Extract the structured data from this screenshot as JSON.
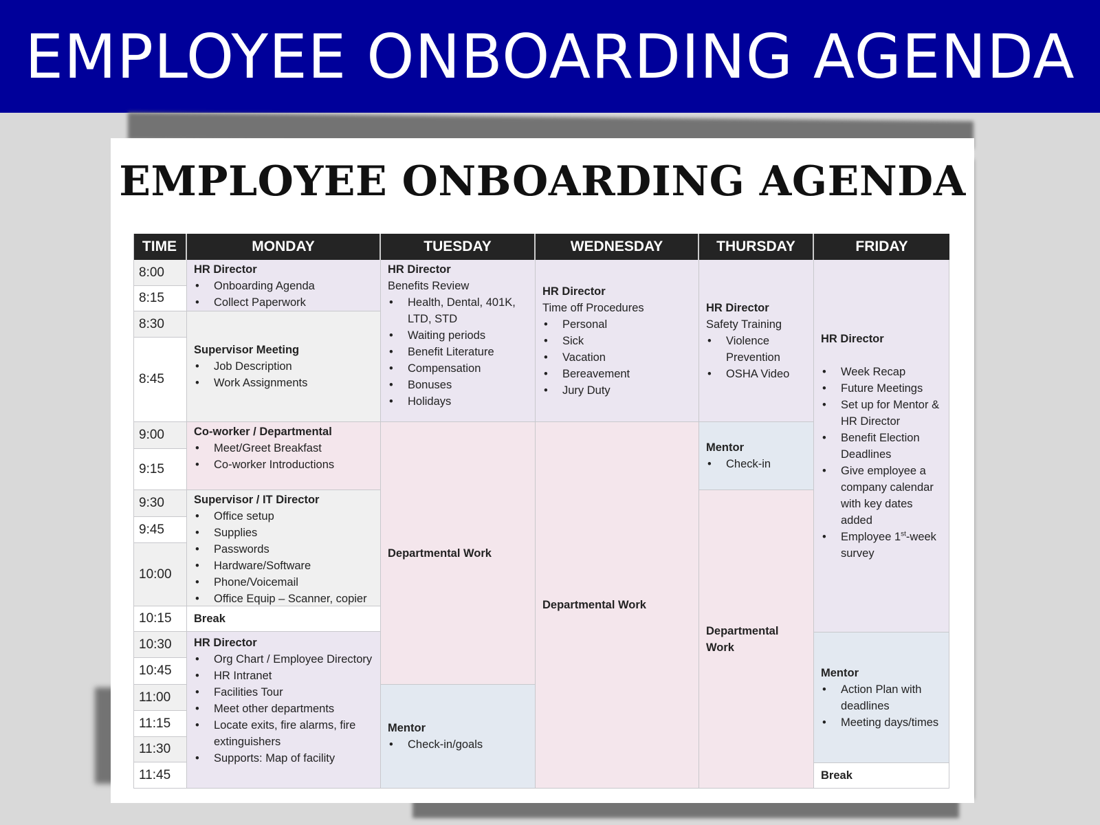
{
  "banner_title": "EMPLOYEE ONBOARDING AGENDA",
  "document_title": "EMPLOYEE ONBOARDING AGENDA",
  "headers": [
    "TIME",
    "MONDAY",
    "TUESDAY",
    "WEDNESDAY",
    "THURSDAY",
    "FRIDAY"
  ],
  "times": [
    "8:00",
    "8:15",
    "8:30",
    "8:45",
    "9:00",
    "9:15",
    "9:30",
    "9:45",
    "10:00",
    "10:15",
    "10:30",
    "10:45",
    "11:00",
    "11:15",
    "11:30",
    "11:45"
  ],
  "monday": {
    "block1": {
      "role": "HR Director",
      "items": [
        "Onboarding Agenda",
        "Collect Paperwork"
      ]
    },
    "block2": {
      "role": "Supervisor Meeting",
      "items": [
        "Job Description",
        "Work Assignments"
      ]
    },
    "block3": {
      "role": "Co-worker / Departmental",
      "items": [
        "Meet/Greet Breakfast",
        "Co-worker Introductions"
      ]
    },
    "block4": {
      "role": "Supervisor / IT Director",
      "items": [
        "Office setup",
        "Supplies",
        "Passwords",
        "Hardware/Software",
        "Phone/Voicemail",
        "Office Equip – Scanner, copier"
      ]
    },
    "block5": {
      "role": "Break"
    },
    "block6": {
      "role": "HR Director",
      "items": [
        "Org Chart / Employee Directory",
        "HR Intranet",
        "Facilities Tour",
        "Meet other departments",
        "Locate exits, fire alarms, fire extinguishers",
        "Supports: Map of facility"
      ]
    }
  },
  "tuesday": {
    "block1": {
      "role": "HR Director",
      "subtitle": "Benefits Review",
      "items": [
        "Health, Dental, 401K, LTD, STD",
        "Waiting periods",
        "Benefit Literature",
        "Compensation",
        "Bonuses",
        "Holidays"
      ]
    },
    "block2": {
      "role": "Departmental Work"
    },
    "block3": {
      "role": "Mentor",
      "items": [
        "Check-in/goals"
      ]
    }
  },
  "wednesday": {
    "block1": {
      "role": "HR Director",
      "subtitle": "Time off Procedures",
      "items": [
        "Personal",
        "Sick",
        "Vacation",
        "Bereavement",
        "Jury Duty"
      ]
    },
    "block2": {
      "role": "Departmental Work"
    }
  },
  "thursday": {
    "block1": {
      "role": "HR Director",
      "subtitle": "Safety Training",
      "items": [
        "Violence Prevention",
        "OSHA Video"
      ]
    },
    "block2": {
      "role": "Mentor",
      "items": [
        "Check-in"
      ]
    },
    "block3": {
      "role": "Departmental Work"
    }
  },
  "friday": {
    "block1": {
      "role": "HR Director",
      "items": [
        "Week Recap",
        "Future Meetings",
        "Set up for Mentor & HR Director",
        "Benefit Election Deadlines",
        "Give employee a company calendar with key dates added"
      ],
      "last_item_prefix": "Employee 1",
      "last_item_sup": "st",
      "last_item_suffix": "-week survey"
    },
    "block2": {
      "role": "Mentor",
      "items": [
        "Action Plan with deadlines",
        "Meeting days/times"
      ]
    },
    "block3": {
      "role": "Break"
    }
  }
}
